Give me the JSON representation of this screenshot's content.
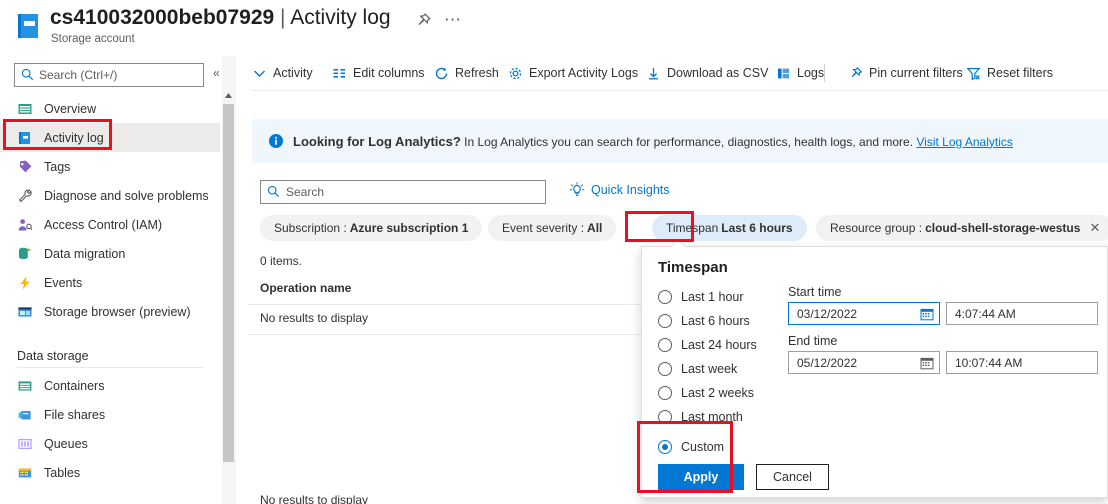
{
  "header": {
    "resource_icon": "storage-account-icon",
    "resource_name": "cs410032000beb07929",
    "separator": "|",
    "page": "Activity log",
    "subtitle": "Storage account",
    "pin_icon": "pin-icon",
    "more_icon": "ellipsis-icon"
  },
  "sidebar": {
    "search": {
      "placeholder": "Search (Ctrl+/)",
      "value": "",
      "icon": "search-icon"
    },
    "collapse_icon": "chevron-double-left-icon",
    "items": [
      {
        "label": "Overview",
        "icon": "overview-icon",
        "color": "#2d9c8a",
        "selected": false
      },
      {
        "label": "Activity log",
        "icon": "activity-log-icon",
        "color": "#0078d4",
        "selected": true
      },
      {
        "label": "Tags",
        "icon": "tags-icon",
        "color": "#8661c5",
        "selected": false
      },
      {
        "label": "Diagnose and solve problems",
        "icon": "wrench-icon",
        "color": "#605e5c",
        "selected": false
      },
      {
        "label": "Access Control (IAM)",
        "icon": "access-control-icon",
        "color": "#8661c5",
        "selected": false
      },
      {
        "label": "Data migration",
        "icon": "data-migration-icon",
        "color": "#2d9c8a",
        "selected": false
      },
      {
        "label": "Events",
        "icon": "events-bolt-icon",
        "color": "#ffb900",
        "selected": false
      },
      {
        "label": "Storage browser (preview)",
        "icon": "storage-browser-icon",
        "color": "#3a96dd",
        "selected": false
      }
    ],
    "group_label": "Data storage",
    "group_items": [
      {
        "label": "Containers",
        "icon": "containers-icon",
        "color": "#2d9c8a"
      },
      {
        "label": "File shares",
        "icon": "file-shares-icon",
        "color": "#3a96dd"
      },
      {
        "label": "Queues",
        "icon": "queues-icon",
        "color": "#b4a0ff"
      },
      {
        "label": "Tables",
        "icon": "tables-icon",
        "color": "#ffb900"
      }
    ],
    "scrollbar": {
      "up_arrow_icon": "scroll-up-arrow-icon"
    }
  },
  "command_bar": {
    "commands": [
      {
        "label": "Activity",
        "icon": "chevron-down-icon"
      },
      {
        "label": "Edit columns",
        "icon": "edit-columns-icon"
      },
      {
        "label": "Refresh",
        "icon": "refresh-icon"
      },
      {
        "label": "Export Activity Logs",
        "icon": "gear-icon"
      },
      {
        "label": "Download as CSV",
        "icon": "download-icon"
      },
      {
        "label": "Logs",
        "icon": "logs-icon"
      },
      {
        "label": "Pin current filters",
        "icon": "pin-filters-icon"
      },
      {
        "label": "Reset filters",
        "icon": "reset-filters-icon"
      }
    ]
  },
  "banner": {
    "icon": "info-icon",
    "bold_text": "Looking for Log Analytics?",
    "text": " In Log Analytics you can search for performance, diagnostics, health logs, and more. ",
    "link": "Visit Log Analytics"
  },
  "filters": {
    "search": {
      "placeholder": "Search",
      "value": "",
      "icon": "search-icon"
    },
    "quick_insights": {
      "label": "Quick Insights",
      "icon": "lightbulb-icon"
    },
    "pills": [
      {
        "key": "Subscription :",
        "value": "Azure subscription 1",
        "active": false,
        "dismissible": false
      },
      {
        "key": "Event severity :",
        "value": "All",
        "active": false,
        "dismissible": false
      },
      {
        "key": "Timespan",
        "value": "Last 6 hours",
        "active": true,
        "dismissible": false
      },
      {
        "key": "Resource group :",
        "value": "cloud-shell-storage-westus",
        "active": false,
        "dismissible": true,
        "close_icon": "close-icon"
      }
    ]
  },
  "results": {
    "items_count": "0 items.",
    "columns": [
      "Operation name"
    ],
    "empty_text": "No results to display",
    "empty_text_ghost": "No results to display"
  },
  "timespan_flyout": {
    "title": "Timespan",
    "options": [
      {
        "label": "Last 1 hour",
        "selected": false
      },
      {
        "label": "Last 6 hours",
        "selected": false
      },
      {
        "label": "Last 24 hours",
        "selected": false
      },
      {
        "label": "Last week",
        "selected": false
      },
      {
        "label": "Last 2 weeks",
        "selected": false
      },
      {
        "label": "Last month",
        "selected": false
      },
      {
        "label": "Custom",
        "selected": true
      }
    ],
    "start_time_label": "Start time",
    "start_date": "03/12/2022",
    "start_time": "4:07:44 AM",
    "end_time_label": "End time",
    "end_date": "05/12/2022",
    "end_time": "10:07:44 AM",
    "calendar_icon": "calendar-icon",
    "apply_label": "Apply",
    "cancel_label": "Cancel"
  },
  "annotations": {
    "accent_color": "#e81123",
    "boxes": [
      "activity-log-nav-item",
      "timespan-pill",
      "custom-and-apply"
    ]
  }
}
